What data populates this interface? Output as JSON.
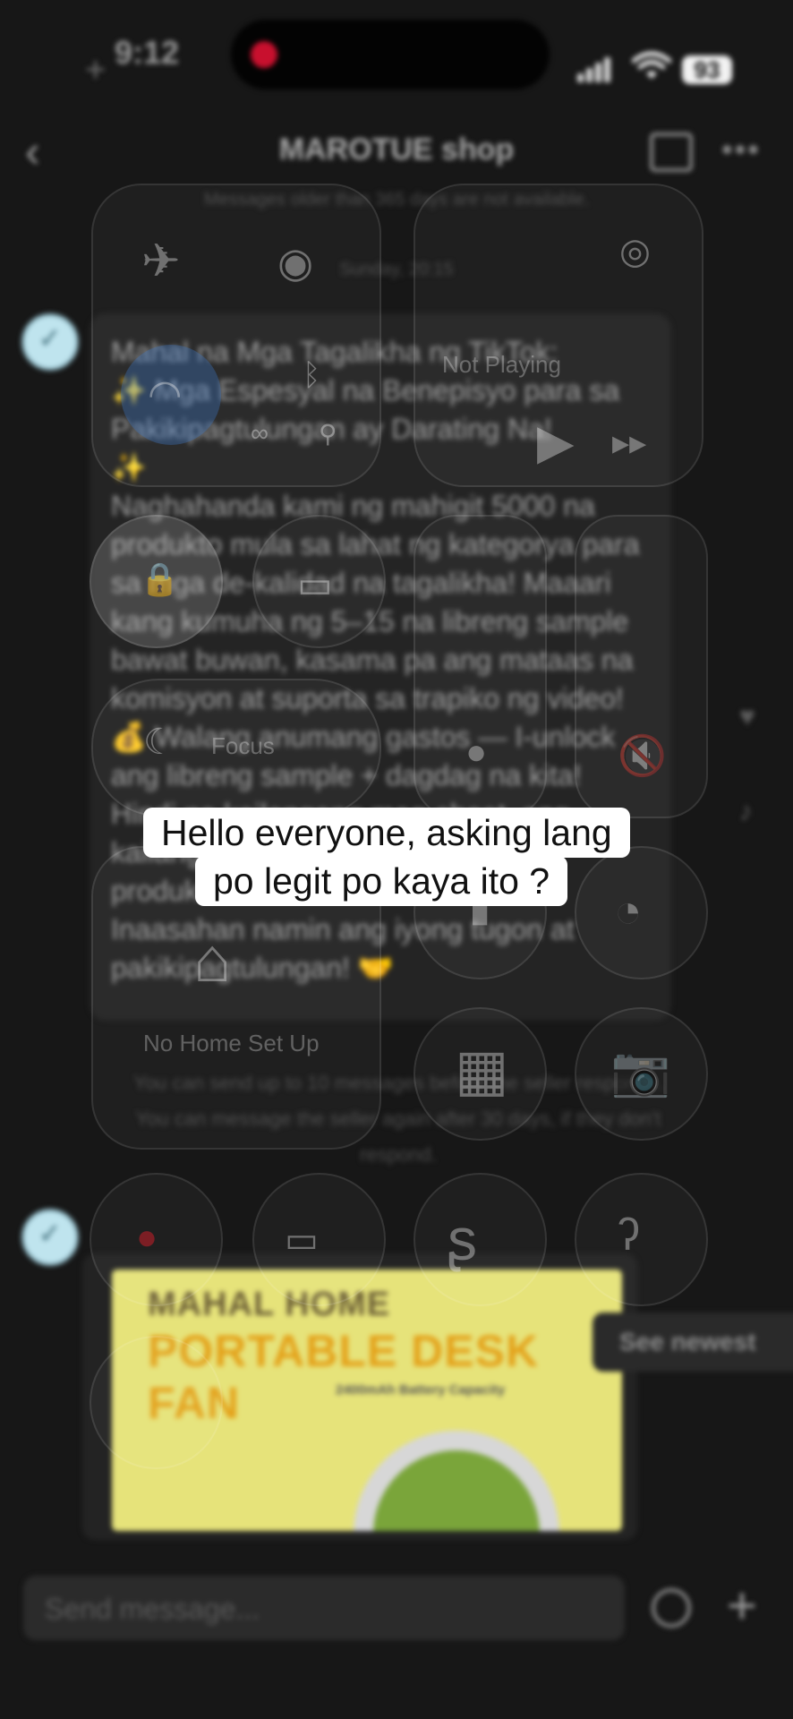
{
  "status_bar": {
    "time": "9:12",
    "battery": "93"
  },
  "header": {
    "title": "MAROTUE shop"
  },
  "chat": {
    "notice": "Messages older than 365 days are not available.",
    "date": "Sunday, 20:15",
    "message_text": "Mahal na Mga Tagalikha ng TikTok:\n✨ Mga Espesyal na Benepisyo para sa Pakikipagtulungan ay Darating Na!\n✨\nNaghahanda kami ng mahigit 5000 na produkto mula sa lahat ng kategorya para sa mga de-kalidad na tagalikha! Maaari kang kumuha ng 5–15 na libreng sample bawat buwan, kasama pa ang mataas na komisyon at suporta sa trapiko ng video!\n💰 Walang anumang gastos — I-unlock ang libreng sample + dagdag na kita! Hindi na kailangang mag-shoot, ang kailangan lang ay ang pagsusuri ng produkto!\nInaasahan namin ang iyong tugon at pakikipagtulungan! 🤝",
    "limit_note": "You can send up to 10 messages before the seller responds. You can message the seller again after 30 days, if they don't respond.",
    "product": {
      "brand": "MAHAL HOME",
      "title": "PORTABLE DESK FAN",
      "battery": "2400mAh Battery Capacity"
    },
    "see_newest": "See newest"
  },
  "input": {
    "placeholder": "Send message..."
  },
  "control_center": {
    "now_playing": "Not Playing",
    "focus": "Focus",
    "home": "No Home Set Up"
  },
  "caption": {
    "line1": "Hello everyone, asking lang",
    "line2": "po legit po kaya ito ?"
  }
}
